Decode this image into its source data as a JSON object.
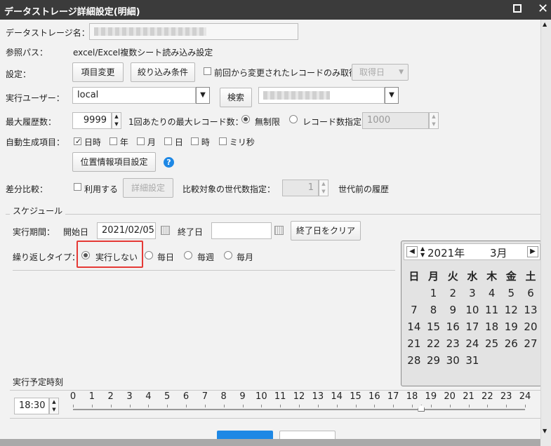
{
  "window": {
    "title": "データストレージ詳細設定(明細)"
  },
  "form": {
    "storage_name_label": "データストレージ名：",
    "ref_path_label": "参照パス：",
    "ref_path_value": "excel/Excel複数シート読み込み設定",
    "settings_label": "設定：",
    "btn_change_fields": "項目変更",
    "btn_filter": "絞り込み条件",
    "only_changed_label": "前回から変更されたレコードのみ取得",
    "btn_fetch_date": "取得日",
    "exec_user_label": "実行ユーザー：",
    "exec_user_value": "local",
    "btn_search": "検索",
    "max_history_label": "最大履歴数：",
    "max_history_value": "9999",
    "max_records_label": "1回あたりの最大レコード数：",
    "unlimited_label": "無制限",
    "record_count_label": "レコード数指定",
    "record_count_value": "1000",
    "autogen_label": "自動生成項目：",
    "autogen_items": [
      {
        "label": "日時",
        "checked": true
      },
      {
        "label": "年",
        "checked": false
      },
      {
        "label": "月",
        "checked": false
      },
      {
        "label": "日",
        "checked": false
      },
      {
        "label": "時",
        "checked": false
      },
      {
        "label": "ミリ秒",
        "checked": false
      }
    ],
    "btn_position_info": "位置情報項目設定",
    "diff_label": "差分比較：",
    "use_label": "利用する",
    "btn_detail_settings": "詳細設定",
    "generation_label": "比較対象の世代数指定：",
    "generation_value": "1",
    "generation_suffix": "世代前の履歴"
  },
  "schedule": {
    "section_title": "スケジュール",
    "period_label": "実行期間：",
    "start_label": "開始日",
    "start_value": "2021/02/05",
    "end_label": "終了日",
    "end_value": "",
    "btn_clear_end": "終了日をクリア",
    "repeat_label": "繰り返しタイプ：",
    "repeat_options": [
      {
        "label": "実行しない",
        "selected": true
      },
      {
        "label": "毎日",
        "selected": false
      },
      {
        "label": "毎週",
        "selected": false
      },
      {
        "label": "毎月",
        "selected": false
      }
    ],
    "planned_time_label": "実行予定時刻",
    "time_value": "18:30",
    "timeline_ticks": [
      "0",
      "1",
      "2",
      "3",
      "4",
      "5",
      "6",
      "7",
      "8",
      "9",
      "10",
      "11",
      "12",
      "13",
      "14",
      "15",
      "16",
      "17",
      "18",
      "19",
      "20",
      "21",
      "22",
      "23",
      "24"
    ],
    "slider_hour": 18.5
  },
  "calendar": {
    "year": "2021年",
    "month": "3月",
    "weekdays": [
      "日",
      "月",
      "火",
      "水",
      "木",
      "金",
      "土"
    ],
    "weeks": [
      [
        "",
        "1",
        "2",
        "3",
        "4",
        "5",
        "6"
      ],
      [
        "7",
        "8",
        "9",
        "10",
        "11",
        "12",
        "13"
      ],
      [
        "14",
        "15",
        "16",
        "17",
        "18",
        "19",
        "20"
      ],
      [
        "21",
        "22",
        "23",
        "24",
        "25",
        "26",
        "27"
      ],
      [
        "28",
        "29",
        "30",
        "31",
        "",
        "",
        ""
      ]
    ]
  },
  "colors": {
    "highlight": "#e53935",
    "primary": "#1e88e5",
    "titlebar": "#3b3b3b"
  }
}
